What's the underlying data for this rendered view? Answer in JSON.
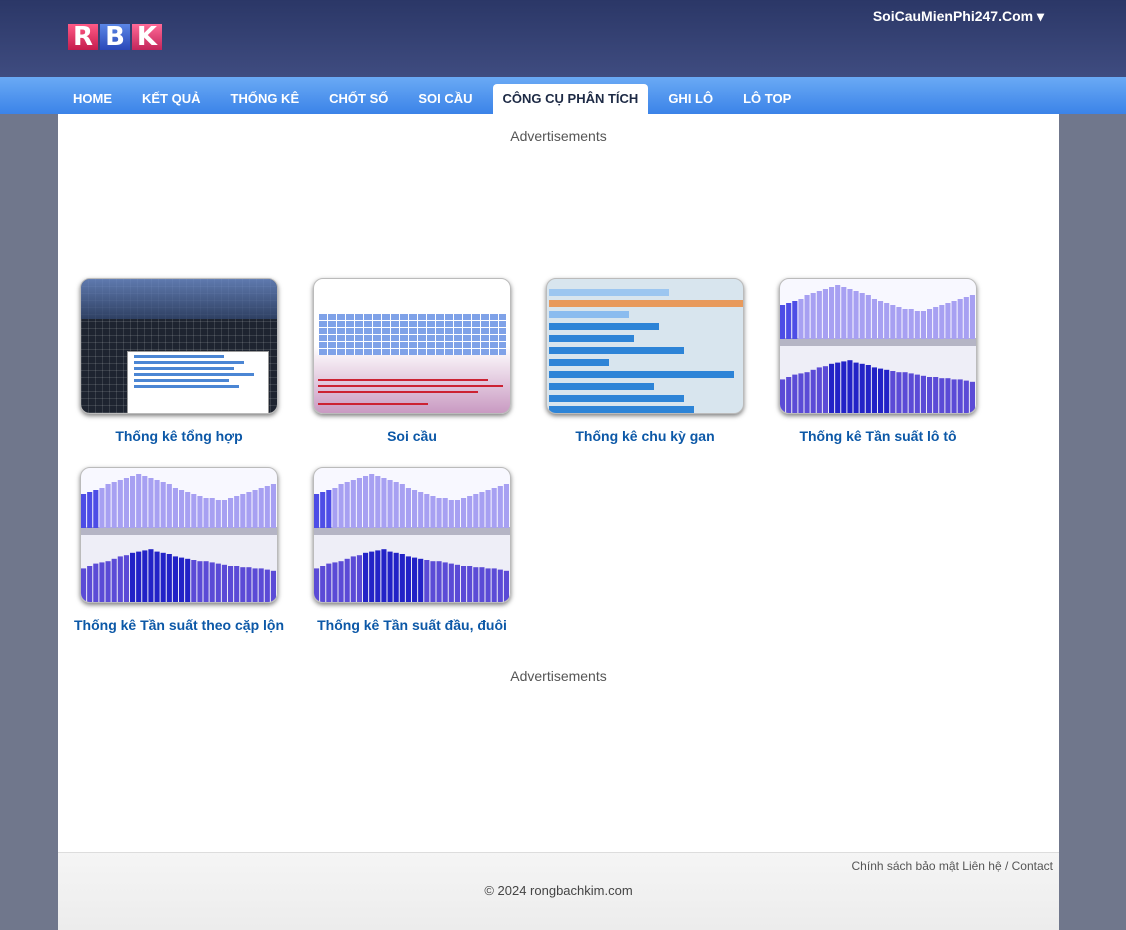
{
  "header": {
    "logo_letters": [
      "R",
      "B",
      "K"
    ],
    "site_link": "SoiCauMienPhi247.Com ▾"
  },
  "nav": {
    "items": [
      "HOME",
      "KẾT QUẢ",
      "THỐNG KÊ",
      "CHỐT SỐ",
      "SOI CẦU",
      "CÔNG CỤ PHÂN TÍCH",
      "GHI LÔ",
      "LÔ TOP"
    ],
    "active_index": 5
  },
  "main": {
    "ads_label": "Advertisements",
    "tools": [
      {
        "title": "Thống kê tổng hợp",
        "thumb": "grid-stats"
      },
      {
        "title": "Soi cầu",
        "thumb": "number-table"
      },
      {
        "title": "Thống kê chu kỳ gan",
        "thumb": "gan-bars"
      },
      {
        "title": "Thống kê Tần suất lô tô",
        "thumb": "frequency-chart"
      },
      {
        "title": "Thống kê Tần suất theo cặp lộn",
        "thumb": "frequency-chart"
      },
      {
        "title": "Thống kê Tần suất đầu, đuôi",
        "thumb": "frequency-chart"
      }
    ]
  },
  "footer": {
    "privacy": "Chính sách bảo mật",
    "contact": "Liên hệ / Contact",
    "copyright": "© 2024 rongbachkim.com"
  },
  "colors": {
    "header_bg": "#2b3767",
    "nav_bg": "#3b83e8",
    "page_bg": "#70778c",
    "link": "#0c58a7"
  }
}
